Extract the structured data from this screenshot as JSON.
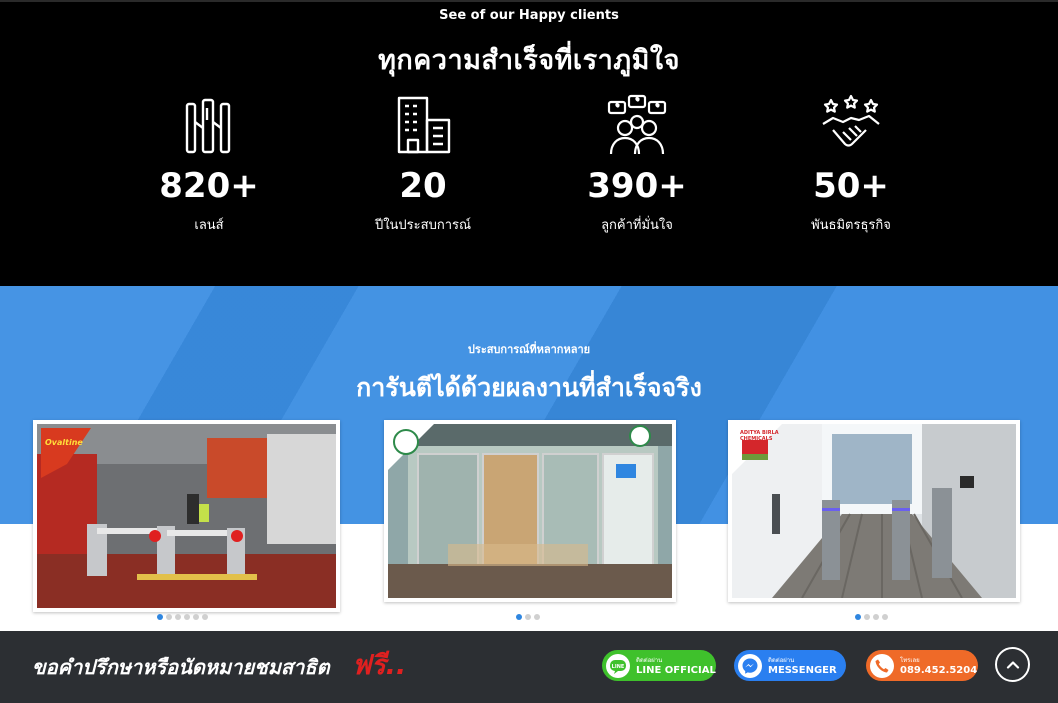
{
  "stats_section": {
    "eyebrow": "See of our Happy clients",
    "title": "ทุกความสำเร็จที่เราภูมิใจ",
    "items": [
      {
        "icon": "turnstile-gate-icon",
        "value": "820+",
        "label": "เลนส์"
      },
      {
        "icon": "office-building-icon",
        "value": "20",
        "label": "ปีในประสบการณ์"
      },
      {
        "icon": "happy-customers-icon",
        "value": "390+",
        "label": "ลูกค้าที่มั่นใจ"
      },
      {
        "icon": "handshake-stars-icon",
        "value": "50+",
        "label": "พันธมิตรธุรกิจ"
      }
    ]
  },
  "portfolio_section": {
    "eyebrow": "ประสบการณ์ที่หลากหลาย",
    "title": "การันตีได้ด้วยผลงานที่สำเร็จจริง",
    "cards": [
      {
        "image": "factory-turnstile-photo",
        "logo_text": "Ovaltine",
        "slides": 6,
        "active": 0
      },
      {
        "image": "glass-door-lobby-photo",
        "logo_text": "",
        "slides": 3,
        "active": 0
      },
      {
        "image": "speed-gate-corridor-photo",
        "logo_text": "ADITYA BIRLA CHEMICALS",
        "slides": 4,
        "active": 0
      }
    ]
  },
  "cta_bar": {
    "message": "ขอคำปรึกษาหรือนัดหมายชมสาธิต",
    "free_label": "ฟรี..",
    "line": {
      "small": "ติดต่อผ่าน",
      "label": "LINE OFFICIAL",
      "color": "#3fc12c"
    },
    "messenger": {
      "small": "ติดต่อผ่าน",
      "label": "MESSENGER",
      "color": "#2a7ff0"
    },
    "phone": {
      "small": "โทรเลย",
      "label": "089.452.5204",
      "color": "#ef6a28"
    }
  },
  "colors": {
    "stats_bg": "#000000",
    "portfolio_blue": "#3a8de2",
    "cta_bg": "#2c2f33",
    "free_red": "#e02020",
    "dot_active": "#2f86e0"
  }
}
